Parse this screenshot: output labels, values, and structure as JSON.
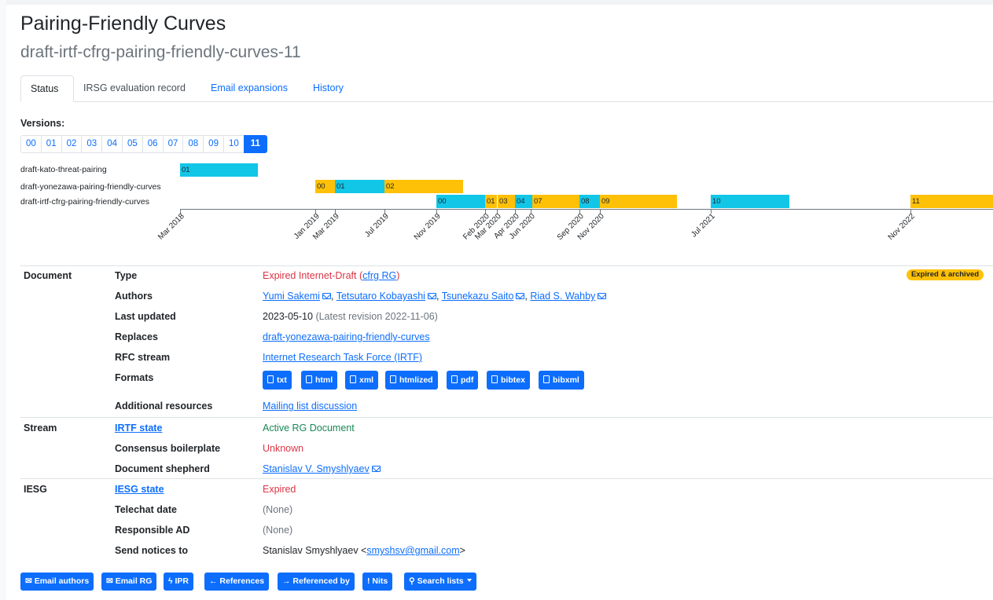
{
  "page": {
    "title": "Pairing-Friendly Curves",
    "subtitle": "draft-irtf-cfrg-pairing-friendly-curves-11"
  },
  "tabs": [
    "Status",
    "IRSG evaluation record",
    "Email expansions",
    "History"
  ],
  "versions": {
    "label": "Versions:",
    "items": [
      "00",
      "01",
      "02",
      "03",
      "04",
      "05",
      "06",
      "07",
      "08",
      "09",
      "10",
      "11"
    ],
    "active": "11"
  },
  "timeline": {
    "rows": [
      {
        "label": "draft-kato-threat-pairing",
        "segments": [
          "01"
        ]
      },
      {
        "label": "draft-yonezawa-pairing-friendly-curves",
        "segments": [
          "00",
          "01",
          "02"
        ]
      },
      {
        "label": "draft-irtf-cfrg-pairing-friendly-curves",
        "segments": [
          "00",
          "01",
          "03",
          "04",
          "07",
          "08",
          "09",
          "10",
          "11"
        ]
      }
    ],
    "axis_labels": [
      "Mar 2018",
      "Jan 2019",
      "Mar 2019",
      "Jul 2019",
      "Nov 2019",
      "Feb 2020",
      "Mar 2020",
      "Apr 2020",
      "Jun 2020",
      "Sep 2020",
      "Nov 2020",
      "Jul 2021",
      "Nov 2022"
    ],
    "colors": {
      "blue": "#12c6e8",
      "yellow": "#ffc107"
    }
  },
  "document": {
    "section": "Document",
    "type_label": "Type",
    "type_value": "Expired Internet-Draft",
    "type_group": "cfrg RG",
    "authors_label": "Authors",
    "authors": [
      "Yumi Sakemi",
      "Tetsutaro Kobayashi",
      "Tsunekazu Saito",
      "Riad S. Wahby"
    ],
    "last_updated_label": "Last updated",
    "last_updated": "2023-05-10",
    "latest_revision": "(Latest revision 2022-11-06)",
    "replaces_label": "Replaces",
    "replaces": "draft-yonezawa-pairing-friendly-curves",
    "rfc_stream_label": "RFC stream",
    "rfc_stream": "Internet Research Task Force (IRTF)",
    "formats_label": "Formats",
    "formats": [
      "txt",
      "html",
      "xml",
      "htmlized",
      "pdf",
      "bibtex",
      "bibxml"
    ],
    "additional_label": "Additional resources",
    "additional": "Mailing list discussion",
    "badge": "Expired & archived"
  },
  "stream": {
    "section": "Stream",
    "state_label": "IRTF state",
    "state_value": "Active RG Document",
    "consensus_label": "Consensus boilerplate",
    "consensus_value": "Unknown",
    "shepherd_label": "Document shepherd",
    "shepherd_value": "Stanislav V. Smyshlyaev"
  },
  "iesg": {
    "section": "IESG",
    "state_label": "IESG state",
    "state_value": "Expired",
    "telechat_label": "Telechat date",
    "telechat_value": "(None)",
    "ad_label": "Responsible AD",
    "ad_value": "(None)",
    "notices_label": "Send notices to",
    "notices_name": "Stanislav Smyshlyaev <",
    "notices_email": "smyshsv@gmail.com",
    "notices_end": ">"
  },
  "actions": [
    "Email authors",
    "Email RG",
    "IPR",
    "References",
    "Referenced by",
    "Nits",
    "Search lists"
  ]
}
